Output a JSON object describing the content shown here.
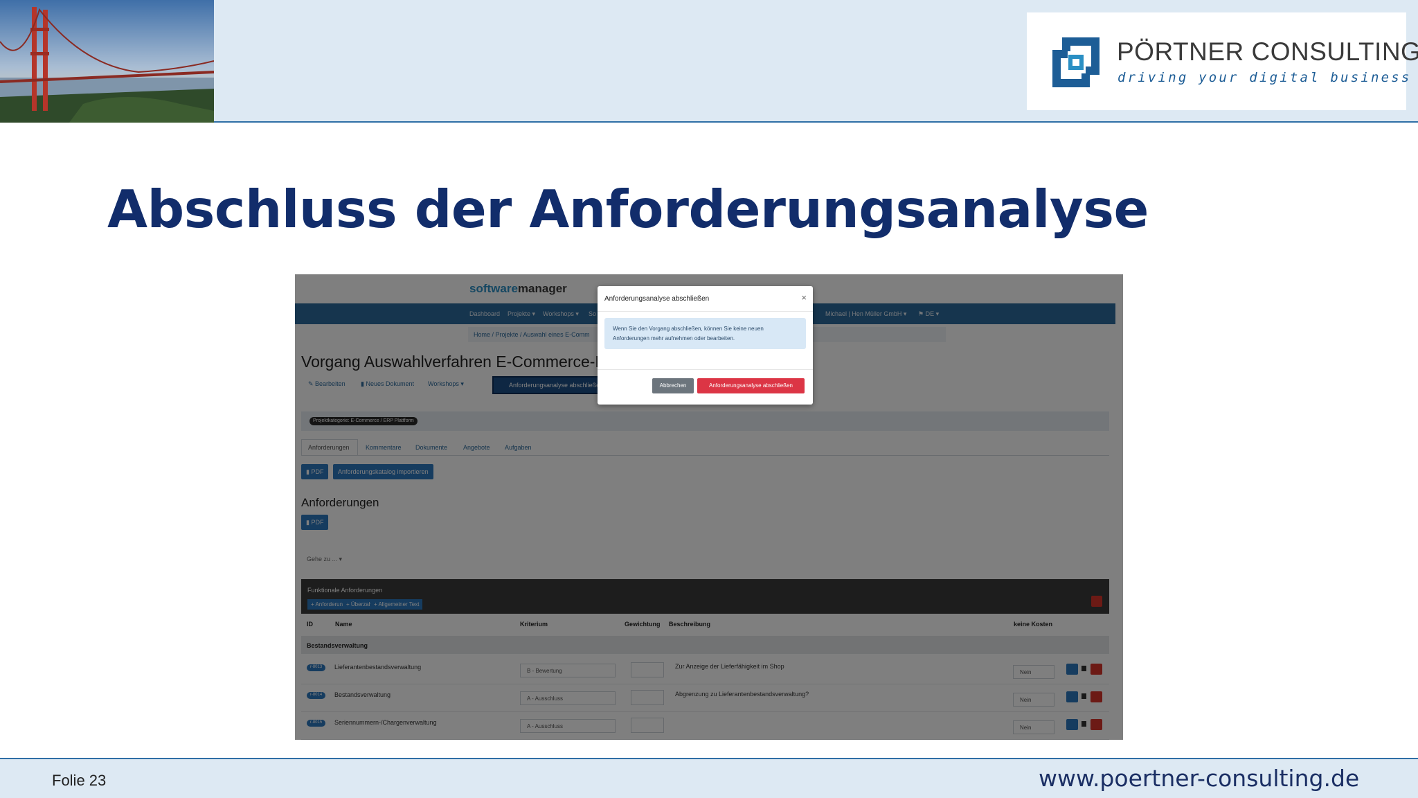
{
  "header": {
    "logo_name": "PÖRTNER CONSULTING",
    "logo_tagline": "driving your digital business"
  },
  "slide": {
    "title": "Abschluss der Anforderungsanalyse",
    "number": "Folie 23",
    "website": "www.poertner-consulting.de"
  },
  "screenshot": {
    "app_logo_a": "software",
    "app_logo_b": "manager",
    "nav": [
      "Dashboard",
      "Projekte ▾",
      "Workshops ▾",
      "So",
      "Michael | Hen Müller GmbH ▾",
      "⚑ DE ▾"
    ],
    "breadcrumb": "Home / Projekte / Auswahl eines E-Comm",
    "page_title": "Vorgang Auswahlverfahren E-Commerce-F",
    "actions": {
      "edit": "✎ Bearbeiten",
      "new_doc": "▮ Neues Dokument",
      "workshops": "Workshops ▾",
      "close_analysis": "Anforderungsanalyse abschließen"
    },
    "category_badge": "Projektkategorie: E-Commerce / ERP Plattform",
    "tabs": [
      "Anforderungen",
      "Kommentare",
      "Dokumente",
      "Angebote",
      "Aufgaben"
    ],
    "buttons": {
      "pdf": "▮ PDF",
      "import_catalog": "Anforderungskatalog importieren",
      "pdf2": "▮ PDF"
    },
    "section_title": "Anforderungen",
    "goto": "Gehe zu ... ▾",
    "functional": {
      "title": "Funktionale Anforderungen",
      "links": [
        "+ Anforderung",
        "+ Überzahl",
        "+ Allgemeiner Text"
      ]
    },
    "table": {
      "headers": [
        "ID",
        "Name",
        "Kriterium",
        "Gewichtung",
        "Beschreibung",
        "keine Kosten"
      ],
      "group": "Bestandsverwaltung",
      "rows": [
        {
          "id": "r-8013",
          "name": "Lieferantenbestandsverwaltung",
          "criterion": "B - Bewertung",
          "description": "Zur Anzeige der Lieferfähigkeit im Shop",
          "cost": "Nein"
        },
        {
          "id": "r-8014",
          "name": "Bestandsverwaltung",
          "criterion": "A - Ausschluss",
          "description": "Abgrenzung zu Lieferantenbestandsverwaltung?",
          "cost": "Nein"
        },
        {
          "id": "r-8015",
          "name": "Seriennummern-/Chargenverwaltung",
          "criterion": "A - Ausschluss",
          "description": "",
          "cost": "Nein"
        }
      ]
    },
    "modal": {
      "title": "Anforderungsanalyse abschließen",
      "close": "×",
      "message_line1": "Wenn Sie den Vorgang abschließen, können Sie keine neuen",
      "message_line2": "Anforderungen mehr aufnehmen oder bearbeiten.",
      "cancel": "Abbrechen",
      "confirm": "Anforderungsanalyse abschließen"
    }
  },
  "colors": {
    "title": "#122d6b",
    "header_bg": "#dde9f3",
    "accent": "#2f6fa6",
    "confirm": "#dc3545",
    "cancel": "#6c757d"
  }
}
